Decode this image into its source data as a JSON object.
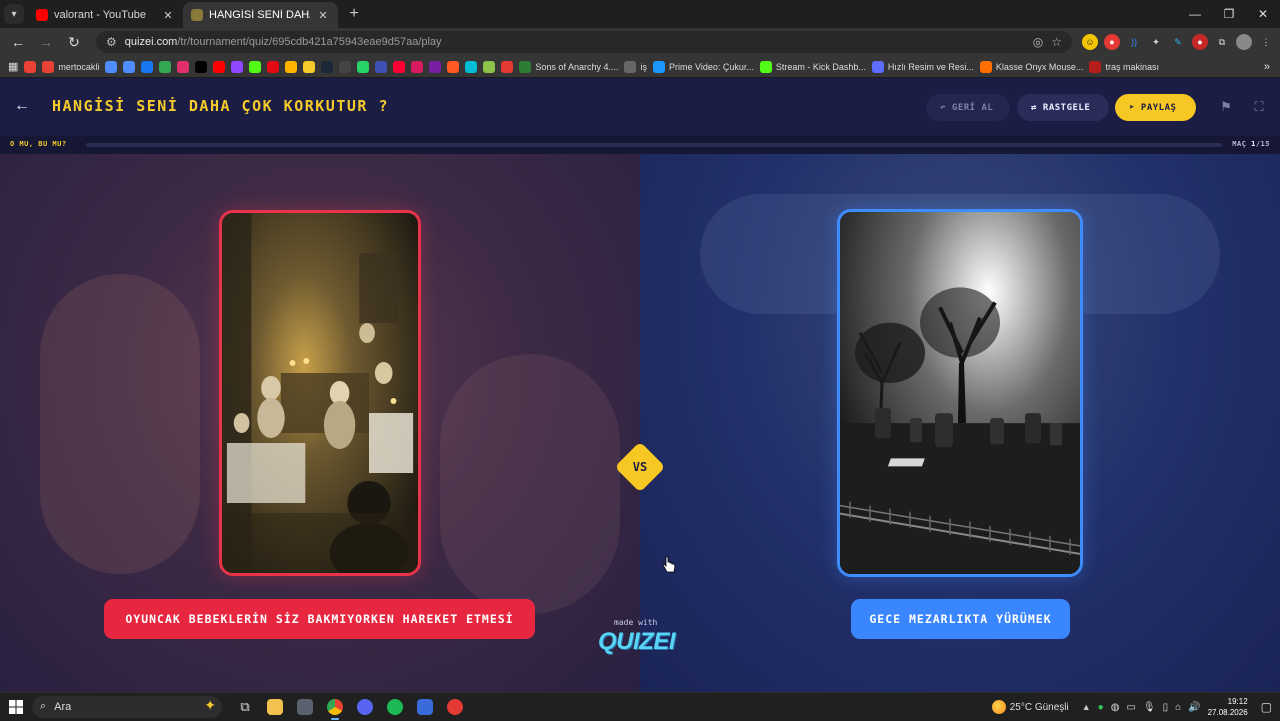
{
  "browser": {
    "tabs": [
      {
        "title": "valorant - YouTube",
        "close": "✕",
        "favicon_color": "#ff0000"
      },
      {
        "title": "HANGİSİ SENİ DAHA ÇOK KORKUTUR ?",
        "close": "✕",
        "favicon_color": "#8a7a3a"
      }
    ],
    "new_tab": "+",
    "url_host": "quizei.com",
    "url_path": "/tr/tournament/quiz/695cdb421a75943eae9d57aa/play"
  },
  "bookmarks": [
    {
      "label": "",
      "color": "#ea4335"
    },
    {
      "label": "mertocakli",
      "color": "#ea4335"
    },
    {
      "label": "",
      "color": "#4e8cff"
    },
    {
      "label": "",
      "color": "#4e8cff"
    },
    {
      "label": "",
      "color": "#1877f2"
    },
    {
      "label": "",
      "color": "#34a853"
    },
    {
      "label": "",
      "color": "#e1306c"
    },
    {
      "label": "",
      "color": "#000000"
    },
    {
      "label": "",
      "color": "#ff0000"
    },
    {
      "label": "",
      "color": "#9146ff"
    },
    {
      "label": "",
      "color": "#53fc18"
    },
    {
      "label": "",
      "color": "#e50914"
    },
    {
      "label": "",
      "color": "#ffb300"
    },
    {
      "label": "",
      "color": "#f5cb2b"
    },
    {
      "label": "",
      "color": "#1b2838"
    },
    {
      "label": "",
      "color": "#444444"
    },
    {
      "label": "",
      "color": "#25d366"
    },
    {
      "label": "",
      "color": "#3f51b5"
    },
    {
      "label": "",
      "color": "#ff0033"
    },
    {
      "label": "",
      "color": "#d81b60"
    },
    {
      "label": "",
      "color": "#7b1fa2"
    },
    {
      "label": "",
      "color": "#ff5722"
    },
    {
      "label": "",
      "color": "#00bcd4"
    },
    {
      "label": "",
      "color": "#8bc34a"
    },
    {
      "label": "",
      "color": "#e53935"
    },
    {
      "label": "Sons of Anarchy 4....",
      "color": "#2e7d32"
    },
    {
      "label": "iş",
      "color": "#666666"
    },
    {
      "label": "Prime Video: Çukur...",
      "color": "#1a98ff"
    },
    {
      "label": "Stream - Kick Dashb...",
      "color": "#53fc18"
    },
    {
      "label": "Hızlı Resim ve Resi...",
      "color": "#5b6cff"
    },
    {
      "label": "Klasse Onyx Mouse...",
      "color": "#ff6f00"
    },
    {
      "label": "traş makinası",
      "color": "#b71c1c"
    }
  ],
  "bookmarks_more": "»",
  "quiz": {
    "title": "HANGİSİ SENİ DAHA ÇOK KORKUTUR ?",
    "undo_label": "GERİ AL",
    "random_label": "RASTGELE",
    "share_label": "PAYLAŞ",
    "round_label": "O MU, BU MU?",
    "match_prefix": "MAÇ",
    "match_current": "1",
    "match_total": "/15",
    "progress": 0.0,
    "vs_label": "VS",
    "left_choice": "OYUNCAK BEBEKLERİN SİZ BAKMIYORKEN HAREKET ETMESİ",
    "right_choice": "GECE MEZARLIKTA YÜRÜMEK",
    "made_with": "made with",
    "brand": "QUIZEI",
    "accent": "#f7c823",
    "left_color": "#e7263f",
    "right_color": "#3a86ff"
  },
  "taskbar": {
    "search_placeholder": "Ara",
    "weather": "25°C  Güneşli",
    "time": "19:12",
    "date": "27.08.2026"
  }
}
